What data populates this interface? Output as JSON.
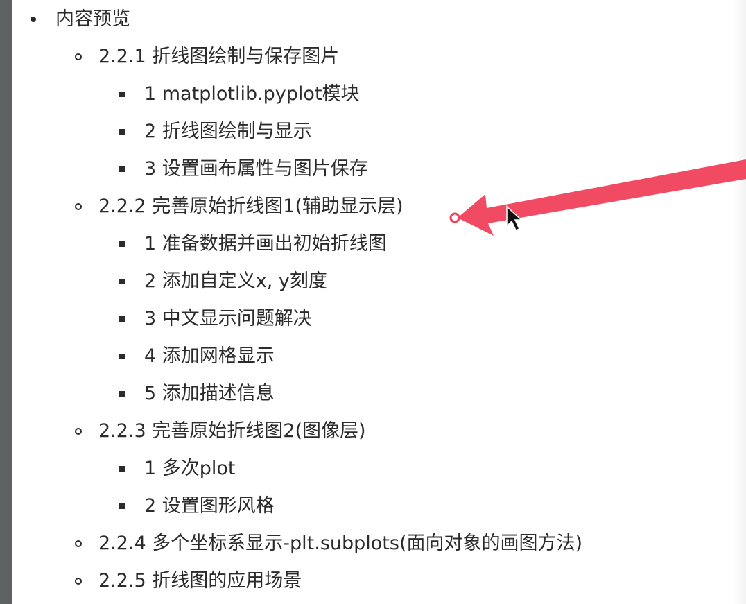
{
  "outline": {
    "root": "内容预览",
    "sections": [
      {
        "title": "2.2.1 折线图绘制与保存图片",
        "items": [
          "1 matplotlib.pyplot模块",
          "2 折线图绘制与显示",
          "3 设置画布属性与图片保存"
        ]
      },
      {
        "title": "2.2.2 完善原始折线图1(辅助显示层)",
        "items": [
          "1 准备数据并画出初始折线图",
          "2 添加自定义x, y刻度",
          "3 中文显示问题解决",
          "4 添加网格显示",
          "5 添加描述信息"
        ]
      },
      {
        "title": "2.2.3 完善原始折线图2(图像层)",
        "items": [
          "1 多次plot",
          "2 设置图形风格"
        ]
      },
      {
        "title": "2.2.4 多个坐标系显示-plt.subplots(面向对象的画图方法)",
        "items": []
      },
      {
        "title": "2.2.5 折线图的应用场景",
        "items": []
      }
    ]
  },
  "colors": {
    "text": "#2b2b2b",
    "arrow": "#f0415b",
    "sidebar": "#5e6162"
  },
  "icons": {
    "bullet_level_1": "filled-disc",
    "bullet_level_2": "hollow-circle",
    "bullet_level_3": "filled-square",
    "annotation": "red-arrow",
    "cursor": "mouse-pointer"
  }
}
